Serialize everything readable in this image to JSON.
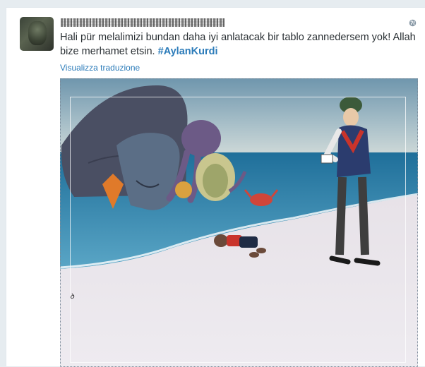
{
  "tweet": {
    "text": "Hali pür melalimizi bundan daha iyi anlatacak bir tablo zannedersem yok! Allah bize merhamet etsin. ",
    "hashtag": "#AylanKurdi",
    "translate_label": "Visualizza traduzione"
  },
  "colors": {
    "link": "#2b7bb9",
    "text": "#292f33",
    "background": "#e6ecf0",
    "card": "#ffffff"
  },
  "icons": {
    "privacy": "globe-icon"
  },
  "media": {
    "artist_signature": "Dadi"
  }
}
